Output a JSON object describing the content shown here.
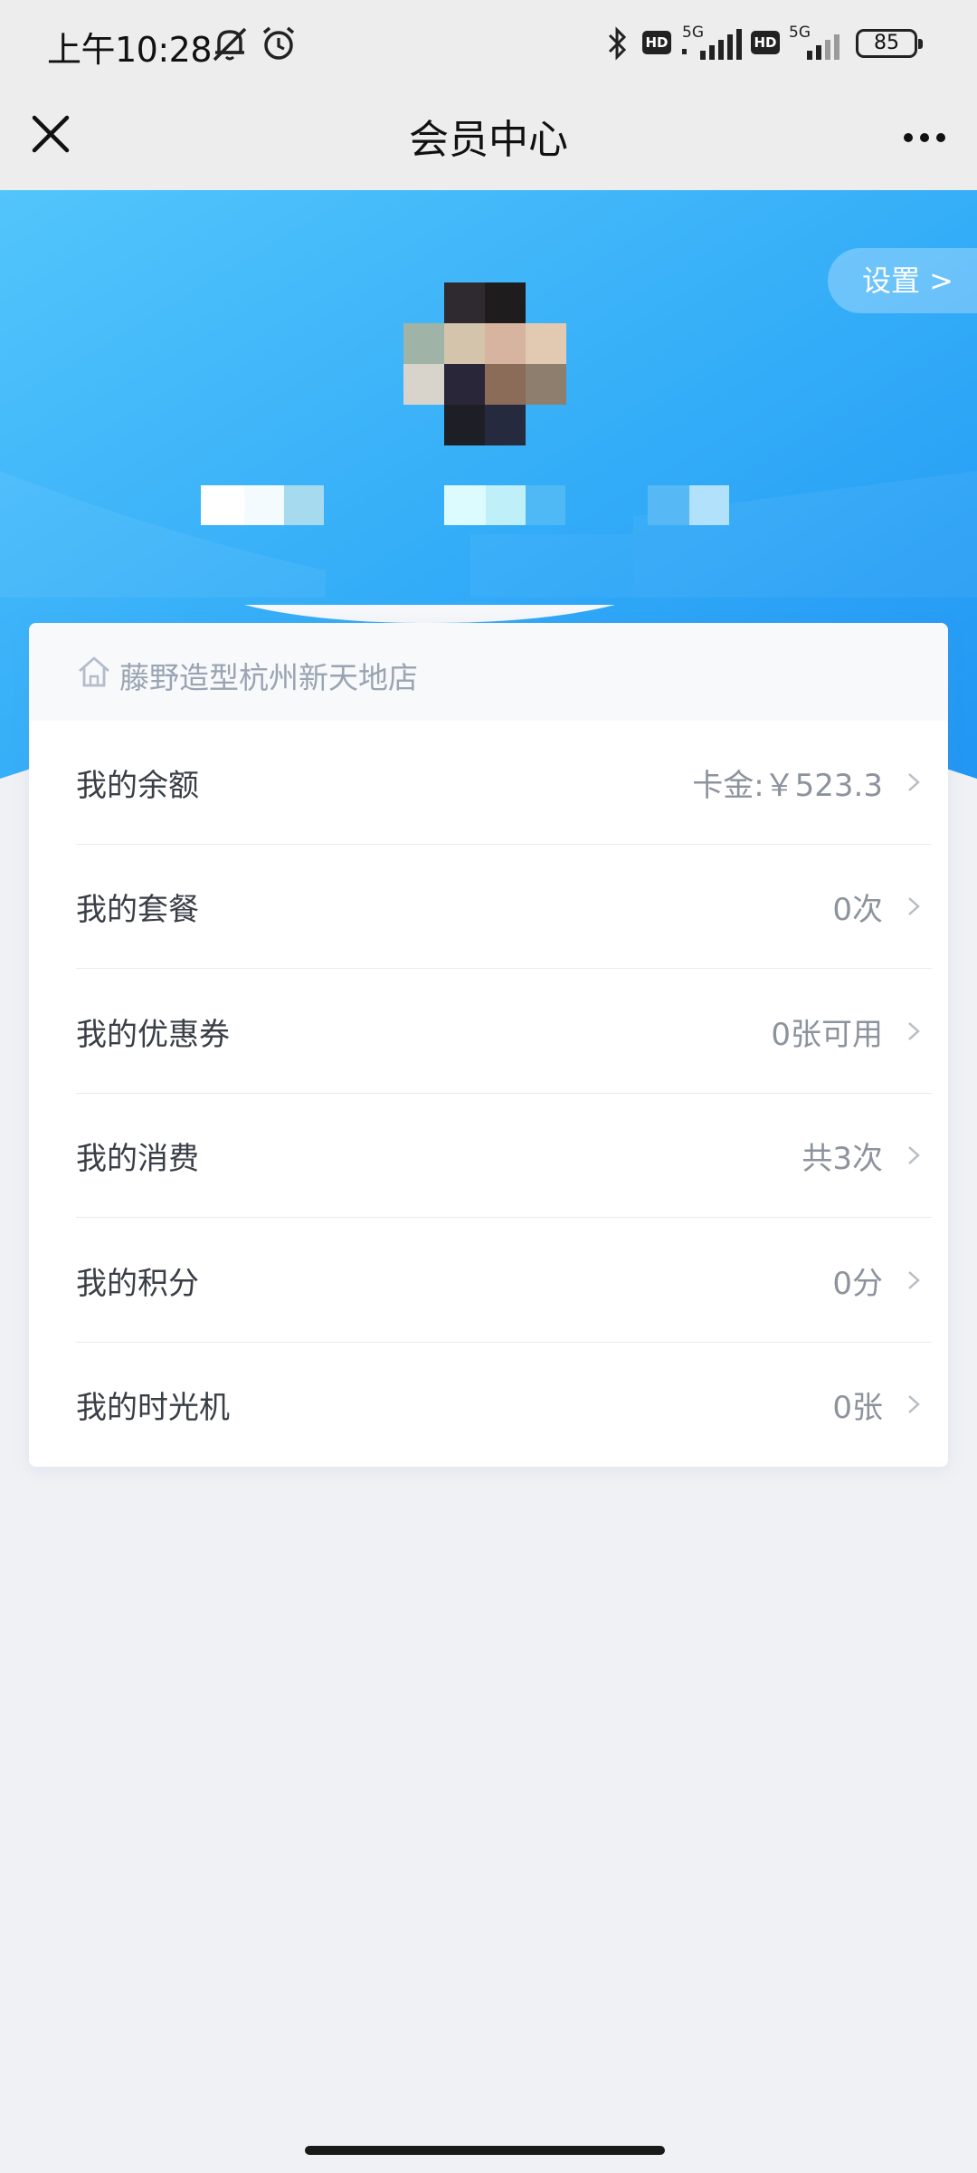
{
  "status_bar": {
    "time": "上午10:28",
    "battery": "85",
    "network_1": "5G",
    "network_2": "5G",
    "hd_1": "HD",
    "hd_2": "HD",
    "icons": [
      "mute-icon",
      "alarm-icon",
      "bluetooth-icon",
      "signal-icon",
      "battery-icon"
    ]
  },
  "title_bar": {
    "title": "会员中心",
    "close_icon": "close-icon",
    "more_icon": "more-icon"
  },
  "hero": {
    "settings_label": "设置 >",
    "gradient_colors": [
      "#4fc3fb",
      "#2ea6f7",
      "#1f94f1"
    ]
  },
  "card": {
    "store_name": "藤野造型杭州新天地店",
    "store_icon": "home-icon",
    "rows": [
      {
        "label": "我的余额",
        "value": "卡金:￥523.3"
      },
      {
        "label": "我的套餐",
        "value": "0次"
      },
      {
        "label": "我的优惠券",
        "value": "0张可用"
      },
      {
        "label": "我的消费",
        "value": "共3次"
      },
      {
        "label": "我的积分",
        "value": "0分"
      },
      {
        "label": "我的时光机",
        "value": "0张"
      }
    ]
  },
  "colors": {
    "accent_blue": "#2ea6f7",
    "page_bg": "#eff1f5",
    "header_bg": "#ededed"
  }
}
